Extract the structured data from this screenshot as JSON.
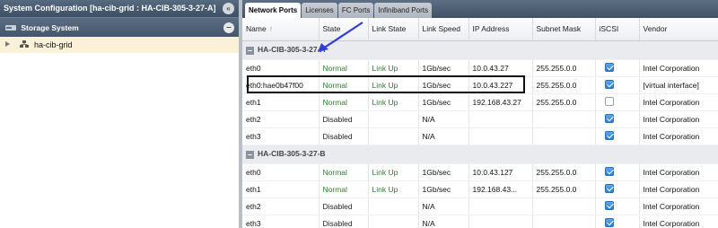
{
  "left": {
    "title": "System Configuration [ha-cib-grid : HA-CIB-305-3-27-A]",
    "collapse_icon": "double-chevron-left-icon",
    "storage_header": "Storage System",
    "storage_icon": "storage-icon",
    "minus_icon": "minus-icon",
    "tree_item": "ha-cib-grid",
    "tree_item_icon": "grid-icon"
  },
  "tabs": [
    "Network Ports",
    "Licenses",
    "FC Ports",
    "Infiniband Ports"
  ],
  "active_tab": "Network Ports",
  "columns": [
    "Name",
    "State",
    "Link State",
    "Link Speed",
    "IP Address",
    "Subnet Mask",
    "iSCSI",
    "Vendor"
  ],
  "sort_indicator": "↑",
  "groups": [
    {
      "name": "HA-CIB-305-3-27-A",
      "rows": [
        {
          "name": "eth0",
          "state": "Normal",
          "link_state": "Link Up",
          "link_speed": "1Gb/sec",
          "ip": "10.0.43.27",
          "subnet": "255.255.0.0",
          "iscsi": true,
          "vendor": "Intel Corporation"
        },
        {
          "name": "eth0:hae0b47f00",
          "state": "Normal",
          "link_state": "Link Up",
          "link_speed": "1Gb/sec",
          "ip": "10.0.43.227",
          "subnet": "255.255.0.0",
          "iscsi": true,
          "vendor": "[virtual interface]"
        },
        {
          "name": "eth1",
          "state": "Normal",
          "link_state": "Link Up",
          "link_speed": "1Gb/sec",
          "ip": "192.168.43.27",
          "subnet": "255.255.0.0",
          "iscsi": false,
          "vendor": "Intel Corporation"
        },
        {
          "name": "eth2",
          "state": "Disabled",
          "link_state": "",
          "link_speed": "N/A",
          "ip": "",
          "subnet": "",
          "iscsi": true,
          "vendor": "Intel Corporation"
        },
        {
          "name": "eth3",
          "state": "Disabled",
          "link_state": "",
          "link_speed": "N/A",
          "ip": "",
          "subnet": "",
          "iscsi": true,
          "vendor": "Intel Corporation"
        }
      ]
    },
    {
      "name": "HA-CIB-305-3-27-B",
      "rows": [
        {
          "name": "eth0",
          "state": "Normal",
          "link_state": "Link Up",
          "link_speed": "1Gb/sec",
          "ip": "10.0.43.127",
          "subnet": "255.255.0.0",
          "iscsi": true,
          "vendor": "Intel Corporation"
        },
        {
          "name": "eth1",
          "state": "Normal",
          "link_state": "Link Up",
          "link_speed": "1Gb/sec",
          "ip": "192.168.43...",
          "subnet": "255.255.0.0",
          "iscsi": true,
          "vendor": "Intel Corporation"
        },
        {
          "name": "eth2",
          "state": "Disabled",
          "link_state": "",
          "link_speed": "N/A",
          "ip": "",
          "subnet": "",
          "iscsi": true,
          "vendor": "Intel Corporation"
        },
        {
          "name": "eth3",
          "state": "Disabled",
          "link_state": "",
          "link_speed": "N/A",
          "ip": "",
          "subnet": "",
          "iscsi": true,
          "vendor": "Intel Corporation"
        }
      ]
    }
  ],
  "annotation": {
    "arrow_color": "#2f3fd6",
    "highlight_color": "#111111"
  },
  "colors": {
    "status_green": "#2e7d32",
    "header_dark": "#3f5165",
    "selected_row": "#fbf1d8"
  }
}
